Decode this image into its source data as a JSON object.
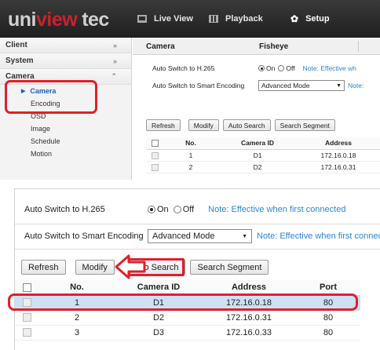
{
  "app": {
    "logo": {
      "uni": "uni",
      "view": "view",
      "tec": "tec"
    },
    "nav": [
      {
        "label": "Live View",
        "icon": "monitor-icon"
      },
      {
        "label": "Playback",
        "icon": "film-icon"
      },
      {
        "label": "Setup",
        "icon": "gear-icon"
      }
    ]
  },
  "sidebar": {
    "groups": [
      {
        "label": "Client",
        "chevron": "»"
      },
      {
        "label": "System",
        "chevron": "»"
      },
      {
        "label": "Camera",
        "chevron": "˄"
      }
    ],
    "camera_items": [
      "Camera",
      "Encoding",
      "OSD",
      "Image",
      "Schedule",
      "Motion"
    ]
  },
  "tabs": [
    "Camera",
    "Fisheye"
  ],
  "form": {
    "h265_label": "Auto Switch to H.265",
    "h265_on": "On",
    "h265_off": "Off",
    "h265_note": "Note: Effective when first connected",
    "smart_label": "Auto Switch to Smart Encoding",
    "smart_value": "Advanced Mode",
    "smart_note": "Note: Effective when first connected",
    "top_h265_note": "Note: Effective wh",
    "top_smart_note": "Note:"
  },
  "toolbar": {
    "refresh": "Refresh",
    "modify": "Modify",
    "auto_search": "Auto Search",
    "search_segment": "Search Segment"
  },
  "table": {
    "headers": [
      "No.",
      "Camera ID",
      "Address",
      "Port"
    ],
    "rows": [
      {
        "no": "1",
        "id": "D1",
        "address": "172.16.0.18",
        "port": "80"
      },
      {
        "no": "2",
        "id": "D2",
        "address": "172.16.0.31",
        "port": "80"
      },
      {
        "no": "3",
        "id": "D3",
        "address": "172.16.0.33",
        "port": "80"
      }
    ]
  },
  "colors": {
    "accent": "#1f5fbf",
    "highlight": "#e0202a",
    "note": "#2e86d6",
    "row_selected": "#cfe0f3"
  }
}
